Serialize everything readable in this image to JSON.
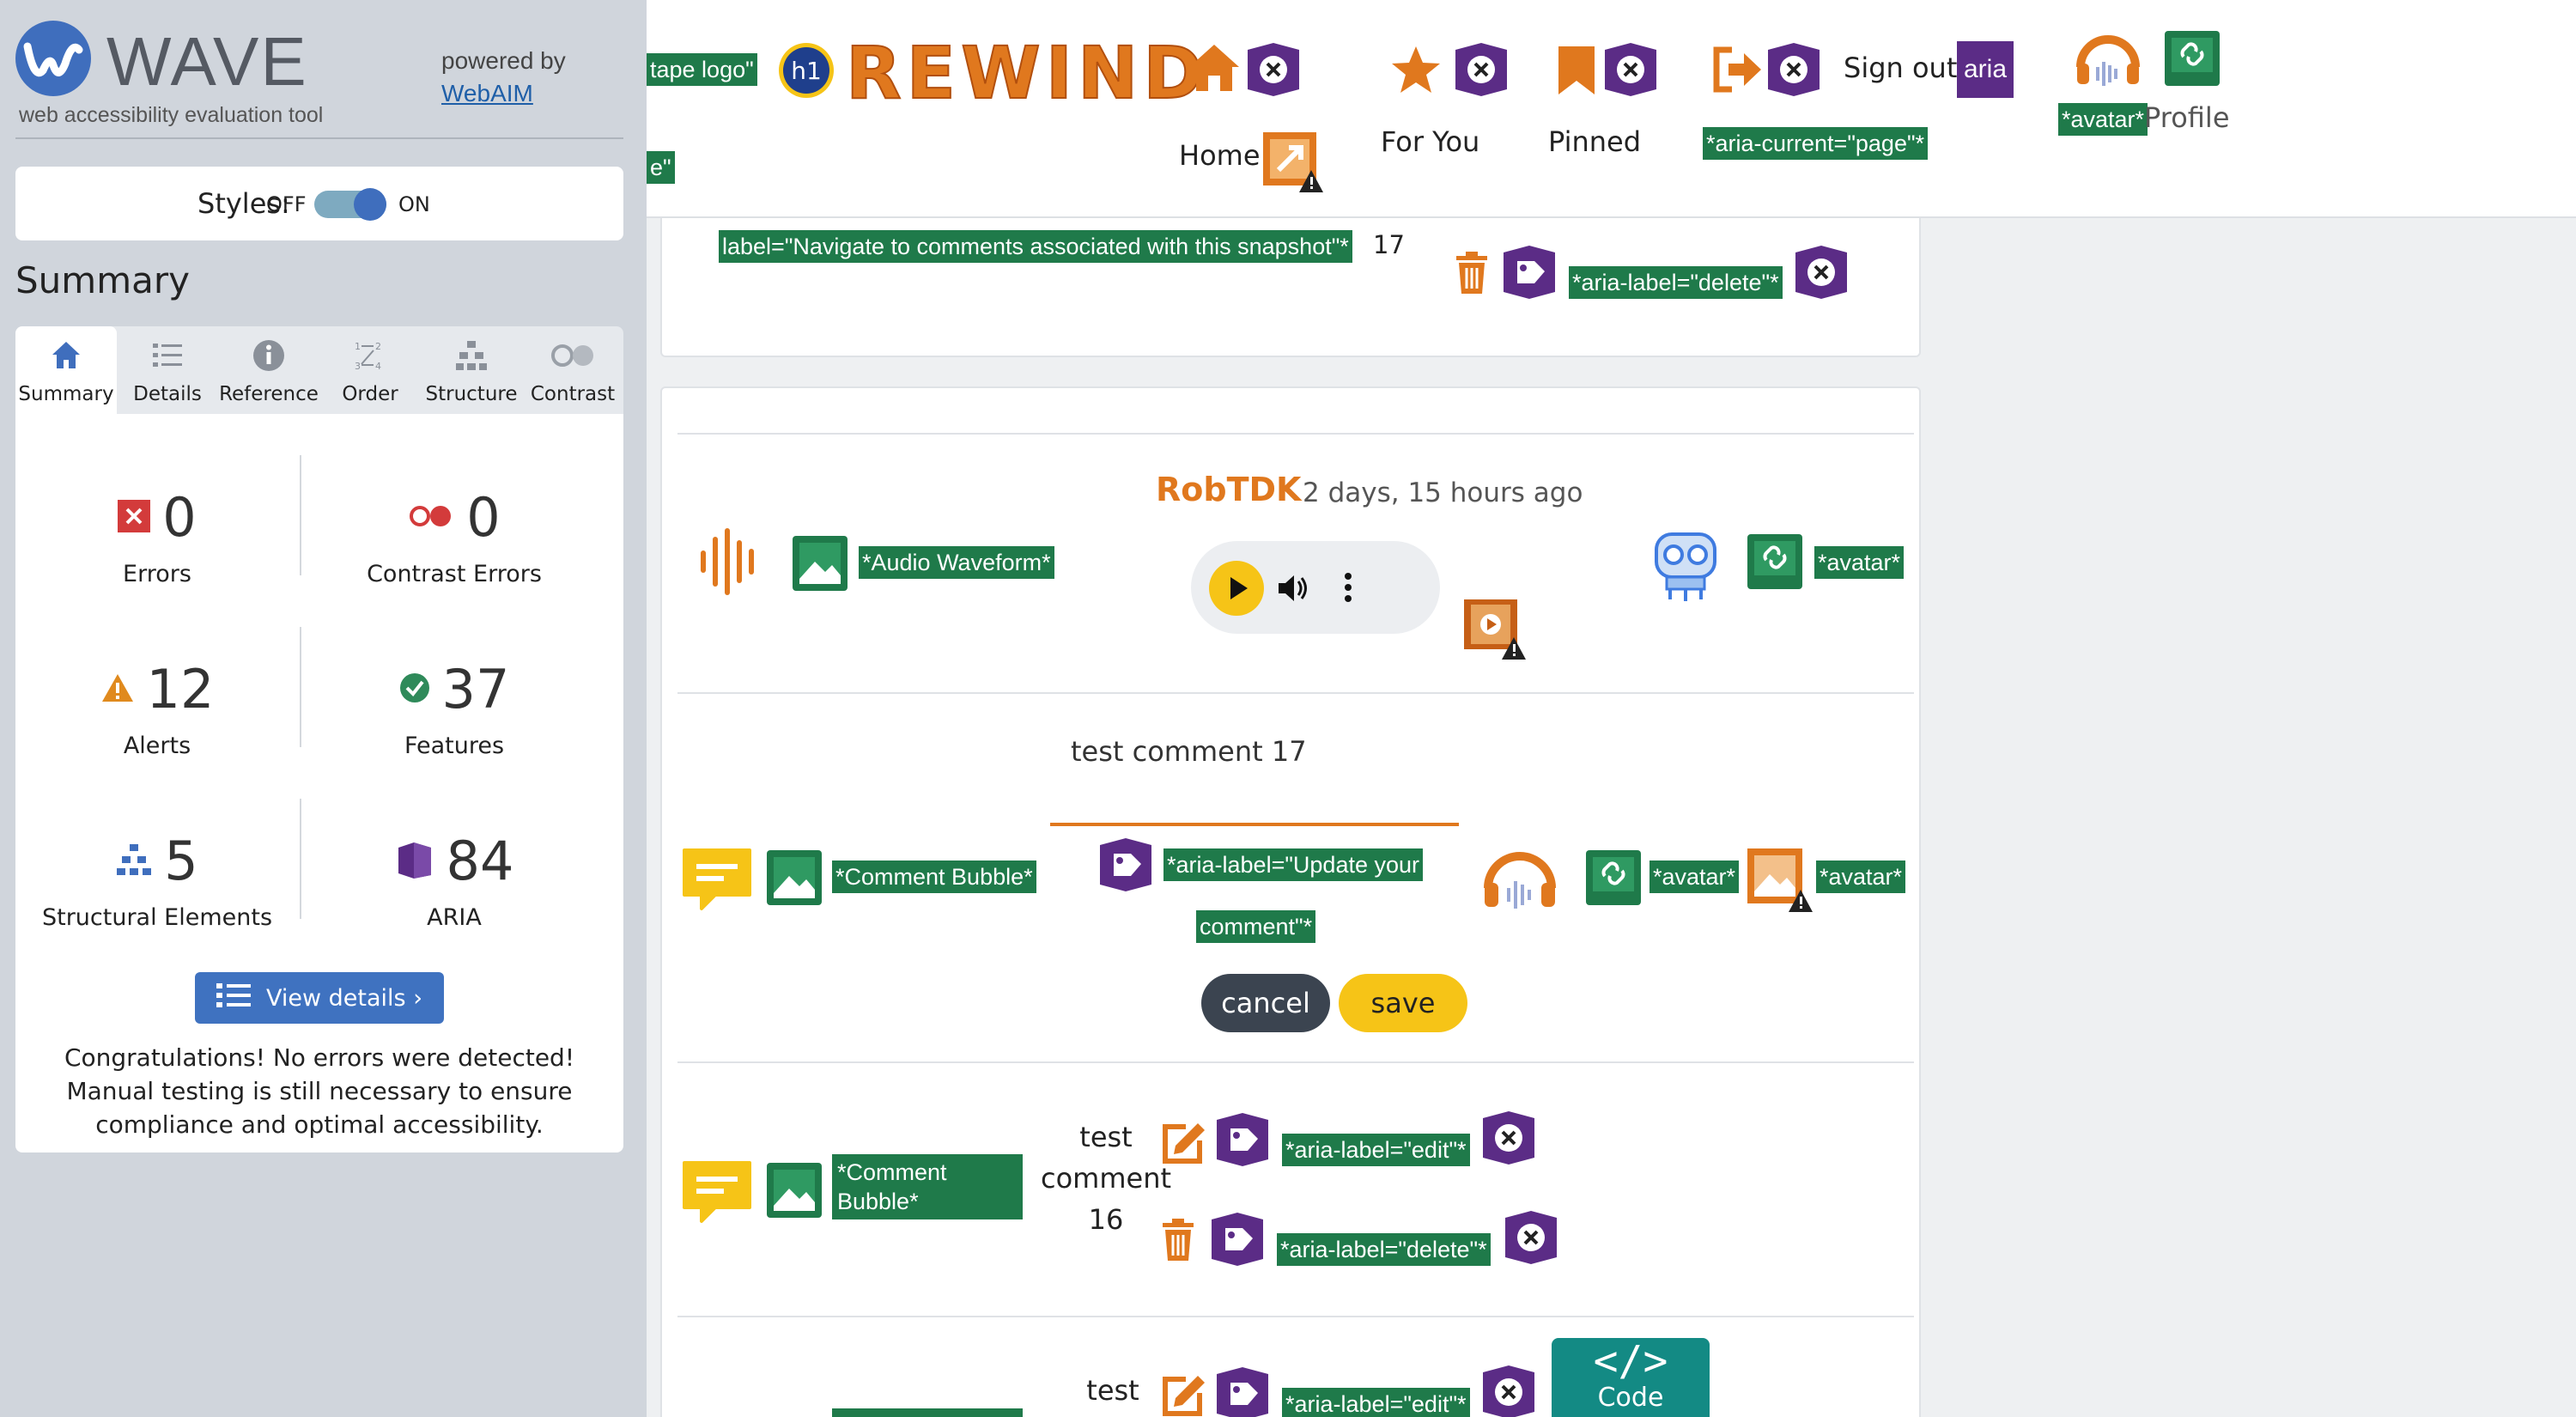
{
  "wave": {
    "logo": "WAVE",
    "subtitle": "web accessibility evaluation tool",
    "powered_by": "powered by",
    "webaim": "WebAIM",
    "styles_label": "Styles:",
    "styles_off": "OFF",
    "styles_on": "ON",
    "summary_heading": "Summary",
    "tabs": [
      {
        "label": "Summary",
        "icon": "home-icon"
      },
      {
        "label": "Details",
        "icon": "list-icon"
      },
      {
        "label": "Reference",
        "icon": "info-icon"
      },
      {
        "label": "Order",
        "icon": "order-icon"
      },
      {
        "label": "Structure",
        "icon": "structure-icon"
      },
      {
        "label": "Contrast",
        "icon": "contrast-icon"
      }
    ],
    "stats": {
      "errors": {
        "value": "0",
        "label": "Errors"
      },
      "contrast": {
        "value": "0",
        "label": "Contrast Errors"
      },
      "alerts": {
        "value": "12",
        "label": "Alerts"
      },
      "features": {
        "value": "37",
        "label": "Features"
      },
      "structural": {
        "value": "5",
        "label": "Structural Elements"
      },
      "aria": {
        "value": "84",
        "label": "ARIA"
      }
    },
    "view_details": "View details ›",
    "congrats": "Congratulations! No errors were detected! Manual testing is still necessary to ensure compliance and optimal accessibility."
  },
  "app": {
    "nav": {
      "tape_logo": "tape logo\"",
      "e_frag": "e\"",
      "h1": "h1",
      "brand": "REWIND",
      "home": "Home",
      "for_you": "For You",
      "pinned": "Pinned",
      "aria_current": "*aria-current=\"page\"*",
      "sign_out": "Sign out",
      "aria_short": "aria",
      "avatar": "*avatar*",
      "profile": "Profile"
    },
    "prev_card": {
      "nav_label": "label=\"Navigate to comments associated with this snapshot\"*",
      "count": "17",
      "delete_label": "*aria-label=\"delete\"*"
    },
    "post": {
      "user": "RobTDK",
      "time": "2 days, 15 hours ago",
      "audio_waveform": "*Audio Waveform*",
      "avatar": "*avatar*",
      "comment_value": "test comment 17",
      "comment_bubble": "*Comment Bubble*",
      "update_label_1": "*aria-label=\"Update your",
      "update_label_2": "comment\"*",
      "cancel": "cancel",
      "save": "save"
    },
    "comment2": {
      "bubble": "*Comment Bubble*",
      "text1": "test",
      "text2": "comment",
      "text3": "16",
      "edit_label": "*aria-label=\"edit\"*",
      "delete_label": "*aria-label=\"delete\"*"
    },
    "comment3": {
      "text": "test",
      "edit_label": "*aria-label=\"edit\"*",
      "code": "Code"
    }
  },
  "colors": {
    "wave_green": "#1f7a4a",
    "wave_purple": "#5b2c86",
    "brand_orange": "#e0781e",
    "save_yellow": "#f6c417",
    "wave_blue": "#3f6ebd"
  }
}
